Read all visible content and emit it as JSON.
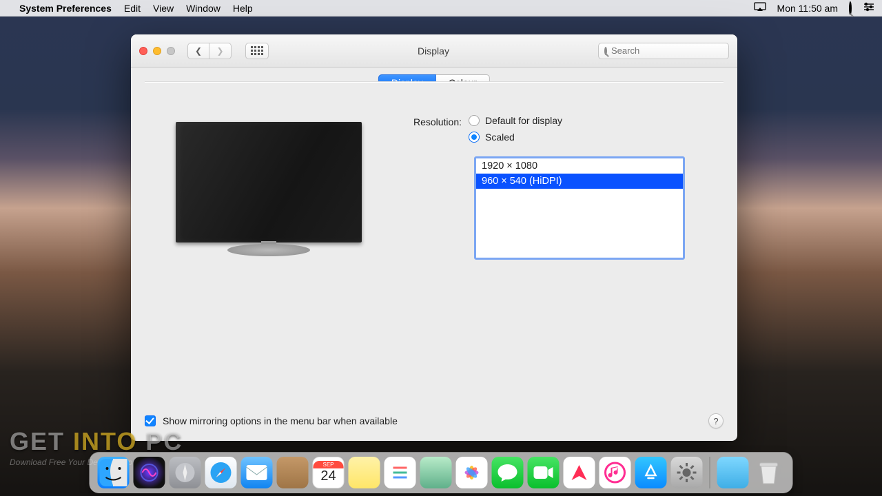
{
  "menubar": {
    "app": "System Preferences",
    "items": [
      "Edit",
      "View",
      "Window",
      "Help"
    ],
    "clock": "Mon 11:50 am"
  },
  "window": {
    "title": "Display",
    "search_placeholder": "Search",
    "tabs": {
      "display": "Display",
      "colour": "Colour"
    },
    "resolution_label": "Resolution:",
    "radio_default": "Default for display",
    "radio_scaled": "Scaled",
    "resolutions": [
      "1920 × 1080",
      "960 × 540 (HiDPI)"
    ],
    "selected_resolution_index": 1,
    "mirror_label": "Show mirroring options in the menu bar when available",
    "help": "?"
  },
  "calendar": {
    "month": "SEP",
    "day": "24"
  },
  "watermark": {
    "a": "GET ",
    "b": "INTO",
    "c": " PC",
    "sub": "Download Free Your Desired App"
  }
}
